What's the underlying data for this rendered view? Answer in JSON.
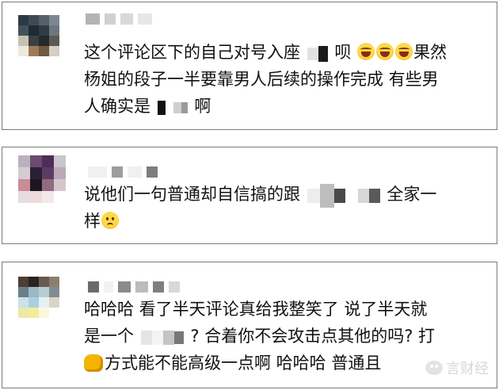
{
  "comments": [
    {
      "text_lines": [
        {
          "before": "这个评论区下的自己对号入座",
          "after": "呗",
          "tail": "果然"
        },
        {
          "text": "杨姐的段子一半要靠男人后续的操作完成 有些男"
        },
        {
          "before": "人确实是",
          "after": "啊"
        }
      ],
      "emoji": [
        "grinning-face-icon",
        "grinning-face-icon",
        "grinning-face-icon"
      ]
    },
    {
      "text_lines": [
        {
          "before": "说他们一句普通却自信搞的跟",
          "after": "全家一"
        },
        {
          "before": "样"
        }
      ],
      "emoji": [
        "pleading-face-icon"
      ]
    },
    {
      "text_lines": [
        {
          "text": "哈哈哈 看了半天评论真给我整笑了 说了半天就"
        },
        {
          "before": "是一个",
          "after": "? 合着你不会攻击点其他的吗? 打"
        },
        {
          "before": "方式能不能高级一点啊 哈哈哈 普通且",
          "after": ""
        }
      ],
      "emoji": [
        "fist-icon"
      ]
    }
  ],
  "watermark": {
    "text": "言财经"
  }
}
